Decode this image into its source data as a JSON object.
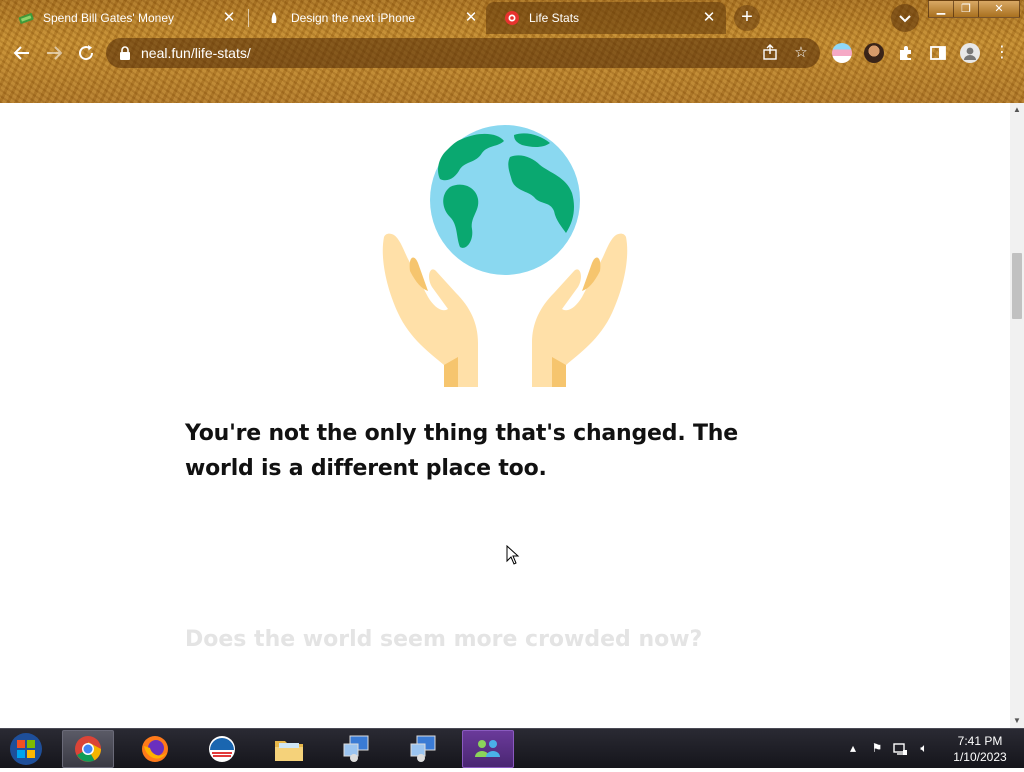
{
  "browser": {
    "tabs": [
      {
        "title": "Spend Bill Gates' Money",
        "active": false
      },
      {
        "title": "Design the next iPhone",
        "active": false
      },
      {
        "title": "Life Stats",
        "active": true
      }
    ],
    "new_tab_label": "+",
    "url": "neal.fun/life-stats/"
  },
  "page": {
    "lead_text": "You're not the only thing that's changed. The world is a different place too.",
    "next_heading": "Does the world seem more crowded now?"
  },
  "taskbar": {
    "time": "7:41 PM",
    "date": "1/10/2023"
  },
  "colors": {
    "chrome_base": "#b07726",
    "globe_ocean": "#8ad8f0",
    "globe_land": "#0aa870",
    "hands": "#ffe0a8",
    "hands_shadow": "#f6c56e"
  }
}
